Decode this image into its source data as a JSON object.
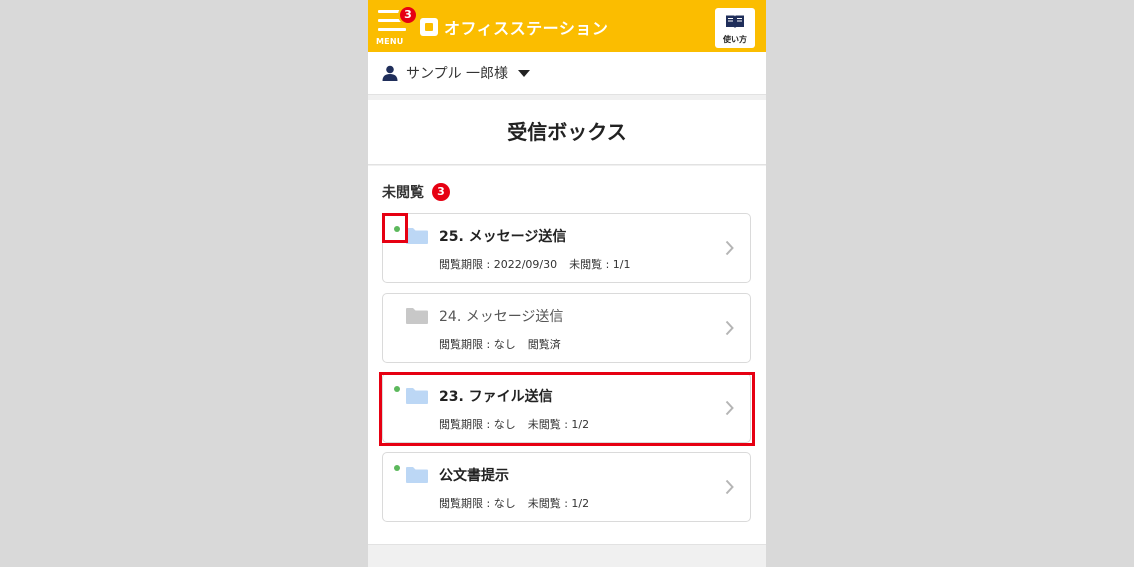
{
  "header": {
    "menu_label": "MENU",
    "menu_badge": "3",
    "app_name": "オフィスステーション",
    "help_label": "使い方",
    "colors": {
      "brand": "#fbbd00",
      "badge": "#e60012"
    }
  },
  "user": {
    "name": "サンプル 一郎様"
  },
  "page": {
    "title": "受信ボックス"
  },
  "section": {
    "label": "未閲覧",
    "badge": "3"
  },
  "items": [
    {
      "title": "25. メッセージ送信",
      "deadline": "閲覧期限 : 2022/09/30",
      "status": "未閲覧 : 1/1",
      "unread": true
    },
    {
      "title": "24. メッセージ送信",
      "deadline": "閲覧期限 : なし",
      "status": "閲覧済",
      "unread": false
    },
    {
      "title": "23. ファイル送信",
      "deadline": "閲覧期限 : なし",
      "status": "未閲覧 : 1/2",
      "unread": true
    },
    {
      "title": "公文書提示",
      "deadline": "閲覧期限 : なし",
      "status": "未閲覧 : 1/2",
      "unread": true
    }
  ],
  "icons": {
    "menu": "hamburger-icon",
    "logo": "logo-mark-icon",
    "help": "book-icon",
    "user": "user-icon",
    "dropdown": "caret-down-icon",
    "folder": "folder-icon",
    "chevron": "chevron-right-icon",
    "unread_dot": "unread-dot-icon"
  },
  "colors": {
    "unread_dot": "#5cb85c",
    "folder_unread": "#bcd7f5",
    "folder_read": "#c8c8c8",
    "highlight": "#e60012"
  }
}
